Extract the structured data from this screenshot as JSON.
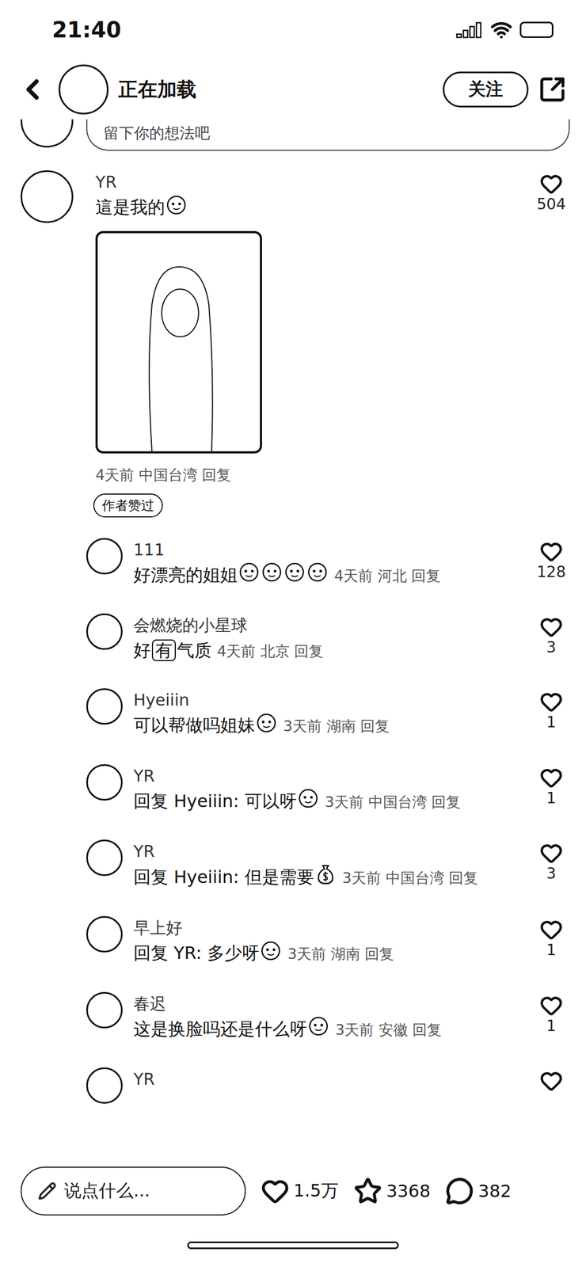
{
  "status_bar": {
    "time": "21:40"
  },
  "header": {
    "title": "正在加载",
    "follow_button": "关注"
  },
  "comment_input_hint": "留下你的想法吧",
  "comments": [
    {
      "author": "YR",
      "parts": [
        {
          "kind": "text",
          "value": "這是我的"
        },
        {
          "kind": "sticker"
        }
      ],
      "time": "4天前",
      "location": "中国台湾",
      "reply_label": "回复",
      "likes": "504",
      "liked": false,
      "badge": "作者赞过",
      "replies": [
        {
          "author": "111",
          "parts": [
            {
              "kind": "text",
              "value": "好漂亮的姐姐"
            },
            {
              "kind": "sticker"
            },
            {
              "kind": "sticker"
            },
            {
              "kind": "sticker"
            },
            {
              "kind": "sticker"
            }
          ],
          "time": "4天前",
          "location": "河北",
          "reply_label": "回复",
          "likes": "128",
          "liked": false
        },
        {
          "author": "会燃烧的小星球",
          "parts": [
            {
              "kind": "text",
              "value": "好"
            },
            {
              "kind": "boxed",
              "value": "有"
            },
            {
              "kind": "text",
              "value": "气质"
            }
          ],
          "time": "4天前",
          "location": "北京",
          "reply_label": "回复",
          "likes": "3",
          "liked": false
        },
        {
          "author": "Hyeiiin",
          "parts": [
            {
              "kind": "text",
              "value": "可以帮做吗姐妹"
            },
            {
              "kind": "sticker"
            }
          ],
          "time": "3天前",
          "location": "湖南",
          "reply_label": "回复",
          "likes": "1",
          "liked": false
        },
        {
          "author": "YR",
          "parts": [
            {
              "kind": "text",
              "value": "回复 Hyeiiin: 可以呀"
            },
            {
              "kind": "sticker"
            }
          ],
          "time": "3天前",
          "location": "中国台湾",
          "reply_label": "回复",
          "likes": "1",
          "liked": false
        },
        {
          "author": "YR",
          "parts": [
            {
              "kind": "text",
              "value": "回复 Hyeiiin: 但是需要"
            },
            {
              "kind": "money"
            }
          ],
          "time": "3天前",
          "location": "中国台湾",
          "reply_label": "回复",
          "likes": "3",
          "liked": false
        },
        {
          "author": "早上好",
          "parts": [
            {
              "kind": "text",
              "value": "回复 YR: 多少呀"
            },
            {
              "kind": "sticker"
            }
          ],
          "time": "3天前",
          "location": "湖南",
          "reply_label": "回复",
          "likes": "1",
          "liked": false
        },
        {
          "author": "春迟",
          "parts": [
            {
              "kind": "text",
              "value": "这是换脸吗还是什么呀"
            },
            {
              "kind": "sticker"
            }
          ],
          "time": "3天前",
          "location": "安徽",
          "reply_label": "回复",
          "likes": "1",
          "liked": false
        },
        {
          "author": "YR",
          "parts": [],
          "liked": false
        }
      ]
    }
  ],
  "bottom_bar": {
    "placeholder": "说点什么...",
    "likes": "1.5万",
    "stars": "3368",
    "comments": "382"
  }
}
